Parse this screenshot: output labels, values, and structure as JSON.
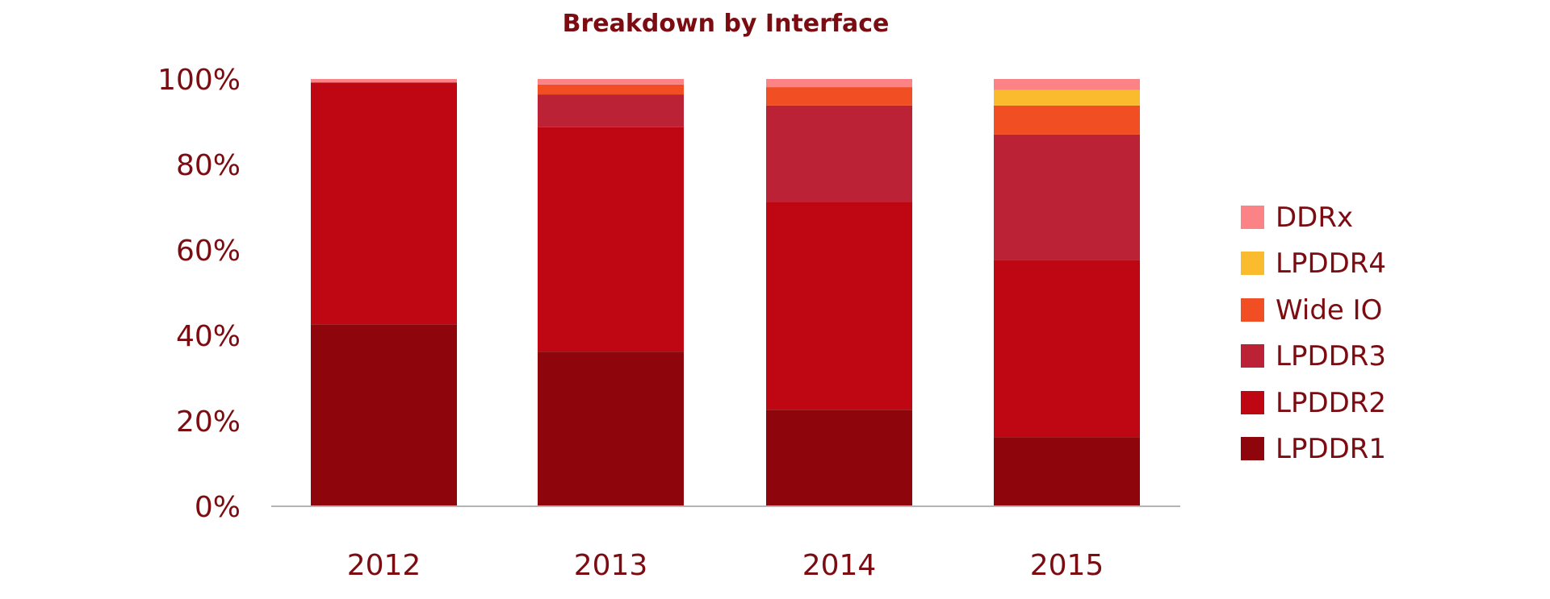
{
  "chart_data": {
    "type": "bar",
    "stacked": true,
    "percent": true,
    "title": "Breakdown by Interface",
    "xlabel": "",
    "ylabel": "",
    "ylim": [
      0,
      100
    ],
    "yticks": [
      "0%",
      "20%",
      "40%",
      "60%",
      "80%",
      "100%"
    ],
    "ytick_values": [
      0,
      20,
      40,
      60,
      80,
      100
    ],
    "grid": false,
    "legend_position": "right",
    "categories": [
      "2012",
      "2013",
      "2014",
      "2015"
    ],
    "series": [
      {
        "name": "LPDDR1",
        "color": "#8e050c",
        "values": [
          42.6,
          36.2,
          22.6,
          16.2
        ]
      },
      {
        "name": "LPDDR2",
        "color": "#be0712",
        "values": [
          56.6,
          52.5,
          48.7,
          41.5
        ]
      },
      {
        "name": "LPDDR3",
        "color": "#bc2236",
        "values": [
          0,
          7.7,
          22.5,
          29.3
        ]
      },
      {
        "name": "Wide IO",
        "color": "#f24e24",
        "values": [
          0,
          2.3,
          4.3,
          6.8
        ]
      },
      {
        "name": "LPDDR4",
        "color": "#fbbb2f",
        "values": [
          0,
          0,
          0,
          3.6
        ]
      },
      {
        "name": "DDRx",
        "color": "#fc8385",
        "values": [
          0.8,
          1.3,
          1.9,
          2.6
        ]
      }
    ],
    "legend_order": [
      "DDRx",
      "LPDDR4",
      "Wide IO",
      "LPDDR3",
      "LPDDR2",
      "LPDDR1"
    ]
  },
  "colors": {
    "text": "#7b0c12",
    "axis": "#b5b5b5"
  }
}
